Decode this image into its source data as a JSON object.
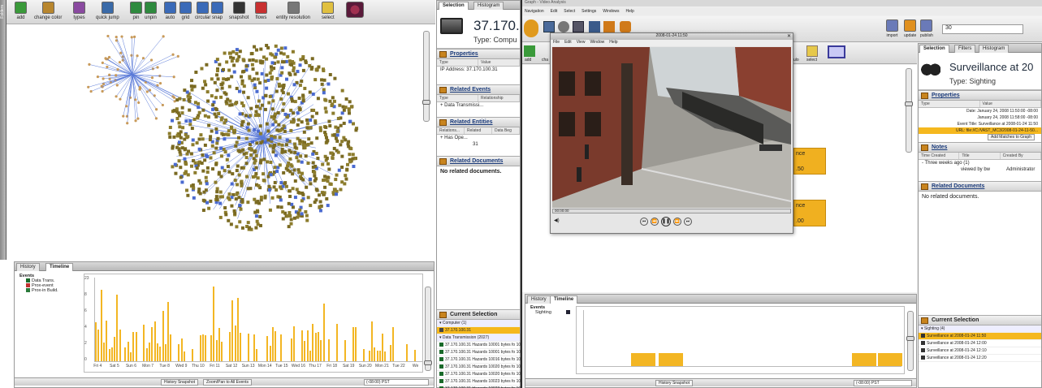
{
  "left": {
    "toolbar": {
      "buttons": [
        {
          "label": "add",
          "color": "#3a9a3a"
        },
        {
          "label": "change color",
          "color": "#b8862e"
        },
        {
          "label": "types",
          "color": "#8a4aa0"
        },
        {
          "label": "quick jump",
          "color": "#3a6aa8"
        },
        {
          "label": "pin",
          "color": "#2e8a3e"
        },
        {
          "label": "unpin",
          "color": "#2e8a3e"
        },
        {
          "label": "auto",
          "color": "#3a6ab8"
        },
        {
          "label": "grid",
          "color": "#3a6ab8"
        },
        {
          "label": "circular",
          "color": "#3a6ab8"
        },
        {
          "label": "snap",
          "color": "#3a6ab8"
        },
        {
          "label": "snapshot",
          "color": "#333333"
        },
        {
          "label": "flows",
          "color": "#c83030"
        },
        {
          "label": "entity resolution",
          "color": "#777777"
        },
        {
          "label": "select",
          "color": "#e0c040"
        }
      ],
      "folders_label": "Folders"
    },
    "timeline": {
      "tabs": [
        "History",
        "Timeline"
      ],
      "events_label": "Events",
      "events": [
        {
          "label": "Data Trans.",
          "color": "#1a6a2a"
        },
        {
          "label": "Prox-event",
          "color": "#c03030"
        },
        {
          "label": "Prox-in Build.",
          "color": "#2a7a3a"
        }
      ],
      "y_ticks": [
        "23",
        "8",
        "6",
        "4",
        "2",
        "0"
      ],
      "x_labels": [
        "Fri 4",
        "Sat 5",
        "Sun 6",
        "Mon 7",
        "Tue 8",
        "Wed 9",
        "Thu 10",
        "Fri 11",
        "Sat 12",
        "Sun 13",
        "Mon 14",
        "Tue 15",
        "Wed 16",
        "Thu 17",
        "Fri 18",
        "Sat 19",
        "Sun 20",
        "Mon 21",
        "Tue 22",
        "We"
      ],
      "history_snapshot": "History Snapshot",
      "zoom_pan": "Zoom/Pan to All Events",
      "timezone": "(-08:00) PST"
    },
    "selection": {
      "tabs": [
        "Selection",
        "Histogram"
      ],
      "title": "37.170.",
      "type": "Type: Compu",
      "properties_head": "Properties",
      "prop_cols": [
        "Type",
        "Value"
      ],
      "prop_row": "IP Address: 37.170.100.31",
      "related_events_head": "Related Events",
      "rel_ev_cols": [
        "Type",
        "Relationship"
      ],
      "rel_ev_row": "Data Transmissi...",
      "related_entities_head": "Related Entities",
      "rel_ent_cols": [
        "Relations...",
        "Related",
        "Data Beg"
      ],
      "rel_ent_row": "Has Ope...",
      "rel_ent_count": "31",
      "related_documents_head": "Related Documents",
      "no_docs": "No related documents.",
      "current_selection_head": "Current Selection",
      "computer_group": "Computer (1)",
      "computer_item": "37.170.100.31",
      "dt_group": "Data Transmission (2027)",
      "dt_items": [
        "37.170.100.31 Hazards 10001 bytes fo 10",
        "37.170.100.31 Hazards 10001 bytes fo 10",
        "37.170.100.31 Hazards 10016 bytes fo 10",
        "37.170.100.31 Hazards 10020 bytes fo 10",
        "37.170.100.31 Hazards 10020 bytes fo 10",
        "37.170.100.31 Hazards 10023 bytes fo 10",
        "37.170.100.31 Hazards 10023 bytes fo 10"
      ]
    }
  },
  "right": {
    "app_title": "Graph - Video Analysis",
    "menu": [
      "Navigation",
      "Edit",
      "Select",
      "Settings",
      "Windows",
      "Help"
    ],
    "top_buttons": [
      "import",
      "update",
      "publish"
    ],
    "zoom_value": "30",
    "video": {
      "menu": [
        "File",
        "Edit",
        "View",
        "Window",
        "Help"
      ],
      "timestamp": "2008-01-24 11:50",
      "time": "00:00:00"
    },
    "toolbar_labels": [
      "add",
      "cha",
      "ulo",
      "select"
    ],
    "pill_texts": [
      "nce",
      ".50",
      "nce",
      ".00"
    ],
    "selection": {
      "tabs": [
        "Selection",
        "Filters",
        "Histogram"
      ],
      "title": "Surveillance at 20",
      "type": "Type: Sighting",
      "properties_head": "Properties",
      "prop_cols": [
        "Type",
        "Value"
      ],
      "prop_rows": [
        "Date: January 24, 2008 11:50:00 -08:00",
        "January 24, 2008 11:58:00 -08:00",
        "Event Title: Surveillance at 2008-01-24 11:50",
        "URL: file://C:/VAST_MC3/2008-01-24-11-50..."
      ],
      "add_matches": "Add Matches to Graph",
      "notes_head": "Notes",
      "notes_cols": [
        "Time Created",
        "Title",
        "Created By"
      ],
      "notes_row": "Three weeks ago (1)",
      "notes_sub": "viewed by bw",
      "notes_author": "Administrator",
      "related_documents_head": "Related Documents",
      "no_docs": "No related documents.",
      "current_selection_head": "Current Selection",
      "sighting_group": "Sighting (4)",
      "sighting_items": [
        "Surveillance at 2008-01-24 11:50",
        "Surveillance at 2008-01-24 12:00",
        "Surveillance at 2008-01-24 12:10",
        "Surveillance at 2008-01-24 12:20"
      ]
    },
    "timeline": {
      "tabs": [
        "History",
        "Timeline"
      ],
      "events_label": "Events",
      "event_item": "Sighting",
      "history_snapshot": "History Snapshot",
      "timezone": "(-08:00) PST"
    }
  }
}
